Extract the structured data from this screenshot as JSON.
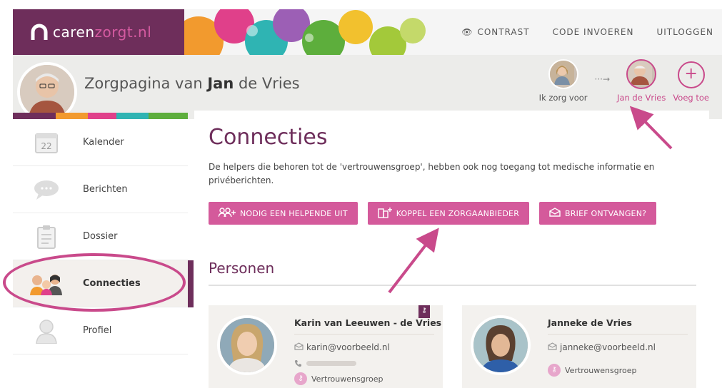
{
  "brand": {
    "name_part1": "caren",
    "name_part2": "zorgt.nl"
  },
  "topnav": {
    "contrast": "CONTRAST",
    "code": "CODE INVOEREN",
    "logout": "UITLOGGEN"
  },
  "profile": {
    "title_prefix": "Zorgpagina van",
    "title_name": "Jan",
    "title_suffix": "de Vries",
    "switcher": {
      "self_label": "Ik zorg voor",
      "active_label": "Jan de Vries",
      "add_label": "Voeg toe"
    }
  },
  "sidebar": {
    "items": [
      {
        "label": "Kalender",
        "icon": "calendar-icon",
        "day": "22"
      },
      {
        "label": "Berichten",
        "icon": "chat-bubble-icon"
      },
      {
        "label": "Dossier",
        "icon": "clipboard-icon"
      },
      {
        "label": "Connecties",
        "icon": "people-icon",
        "active": true
      },
      {
        "label": "Profiel",
        "icon": "person-icon"
      }
    ]
  },
  "main": {
    "title": "Connecties",
    "intro": "De helpers die behoren tot de 'vertrouwensgroep', hebben ook nog toegang tot medische informatie en privéberichten.",
    "buttons": [
      {
        "label": "NODIG EEN HELPENDE UIT",
        "icon": "invite-people-icon"
      },
      {
        "label": "KOPPEL EEN ZORGAANBIEDER",
        "icon": "building-add-icon"
      },
      {
        "label": "BRIEF ONTVANGEN?",
        "icon": "letter-icon"
      }
    ],
    "section_title": "Personen",
    "persons": [
      {
        "name": "Karin van Leeuwen - de Vries",
        "email": "karin@voorbeeld.nl",
        "group": "Vertrouwensgroep"
      },
      {
        "name": "Janneke de Vries",
        "email": "janneke@voorbeeld.nl",
        "group": "Vertrouwensgroep"
      }
    ]
  },
  "colors": {
    "brand": "#6e2e5b",
    "accent": "#d45a9b",
    "annotation": "#c94a8b"
  }
}
